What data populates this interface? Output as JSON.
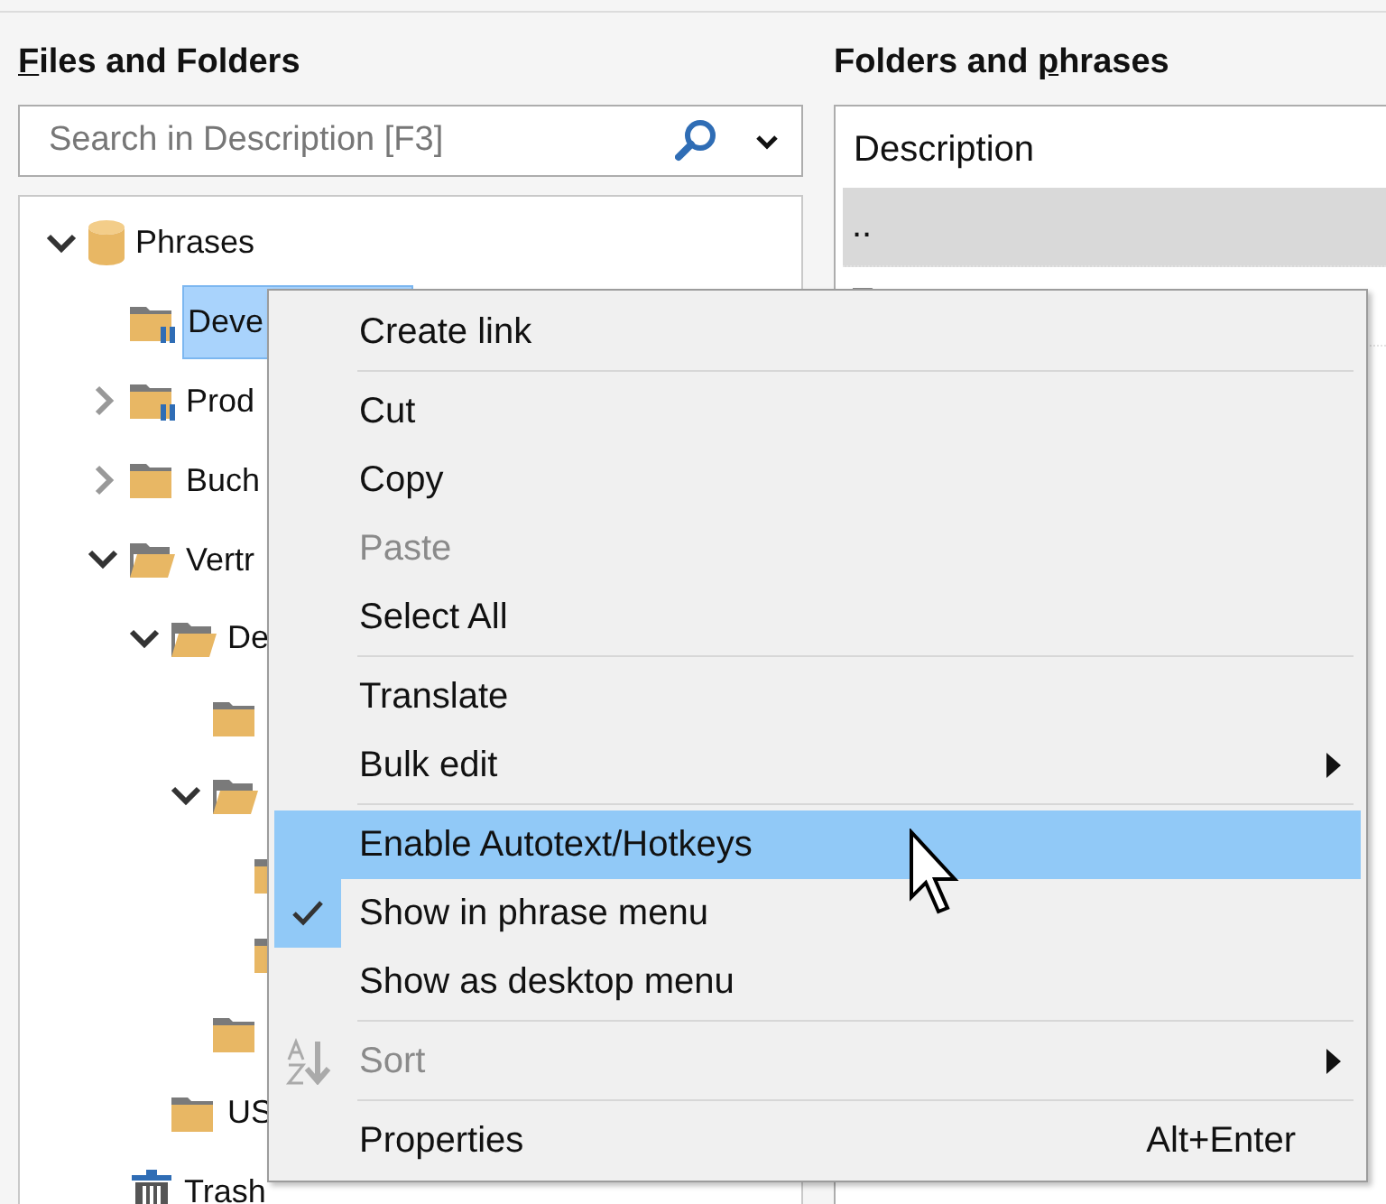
{
  "left_panel": {
    "title": [
      {
        "text": "F",
        "underlined": true
      },
      {
        "text": "iles and Folders",
        "underlined": false
      }
    ],
    "search": {
      "placeholder": "Search in Description [F3]"
    },
    "tree": [
      {
        "label": "Phrases",
        "kind": "database",
        "expanded": true,
        "selected": false,
        "children": [
          {
            "label": "Deve",
            "kind": "shared-folder",
            "selected": true
          },
          {
            "label": "Prod",
            "kind": "shared-folder",
            "expanded": false,
            "selected": false
          },
          {
            "label": "Buch",
            "kind": "folder",
            "expanded": false,
            "selected": false
          },
          {
            "label": "Vertr",
            "kind": "folder",
            "expanded": true,
            "selected": false,
            "children": [
              {
                "label": "De",
                "kind": "folder",
                "expanded": true,
                "selected": false,
                "children": [
                  {
                    "kind": "folder"
                  },
                  {
                    "kind": "folder",
                    "expanded": true,
                    "children": [
                      {
                        "kind": "folder"
                      },
                      {
                        "kind": "folder"
                      }
                    ]
                  },
                  {
                    "kind": "folder"
                  }
                ]
              },
              {
                "label": "US",
                "kind": "folder",
                "selected": false
              }
            ]
          },
          {
            "label": "Trash",
            "kind": "trash",
            "selected": false
          }
        ]
      }
    ]
  },
  "right_panel": {
    "title": [
      {
        "text": "Folders and ",
        "underlined": false
      },
      {
        "text": "p",
        "underlined": true
      },
      {
        "text": "hrases",
        "underlined": false
      }
    ],
    "columns": [
      "Description"
    ],
    "rows": [
      {
        "label": "..",
        "kind": "parent",
        "selected": true
      },
      {
        "kind": "phrase",
        "selected": false
      }
    ]
  },
  "context_menu": [
    {
      "kind": "command",
      "label": "Create link",
      "disabled": false,
      "checked": false,
      "selected": false,
      "submenu": false
    },
    {
      "kind": "separator"
    },
    {
      "kind": "command",
      "label": "Cut",
      "disabled": false,
      "checked": false,
      "selected": false,
      "submenu": false
    },
    {
      "kind": "command",
      "label": "Copy",
      "disabled": false,
      "checked": false,
      "selected": false,
      "submenu": false
    },
    {
      "kind": "command",
      "label": "Paste",
      "disabled": true,
      "checked": false,
      "selected": false,
      "submenu": false
    },
    {
      "kind": "command",
      "label": "Select All",
      "disabled": false,
      "checked": false,
      "selected": false,
      "submenu": false
    },
    {
      "kind": "separator"
    },
    {
      "kind": "command",
      "label": "Translate",
      "disabled": false,
      "checked": false,
      "selected": false,
      "submenu": false
    },
    {
      "kind": "command",
      "label": "Bulk edit",
      "disabled": false,
      "checked": false,
      "selected": false,
      "submenu": true
    },
    {
      "kind": "separator"
    },
    {
      "kind": "command",
      "label": "Enable Autotext/Hotkeys",
      "disabled": false,
      "checked": false,
      "selected": true,
      "submenu": false
    },
    {
      "kind": "command",
      "label": "Show in phrase menu",
      "disabled": false,
      "checked": true,
      "selected": false,
      "submenu": false
    },
    {
      "kind": "command",
      "label": "Show as desktop menu",
      "disabled": false,
      "checked": false,
      "selected": false,
      "submenu": false
    },
    {
      "kind": "separator"
    },
    {
      "kind": "sort-command",
      "label": "Sort",
      "disabled": true,
      "checked": false,
      "selected": false,
      "submenu": true
    },
    {
      "kind": "separator"
    },
    {
      "kind": "command",
      "label": "Properties",
      "shortcut": "Alt+Enter",
      "disabled": false,
      "checked": false,
      "selected": false,
      "submenu": false
    }
  ]
}
